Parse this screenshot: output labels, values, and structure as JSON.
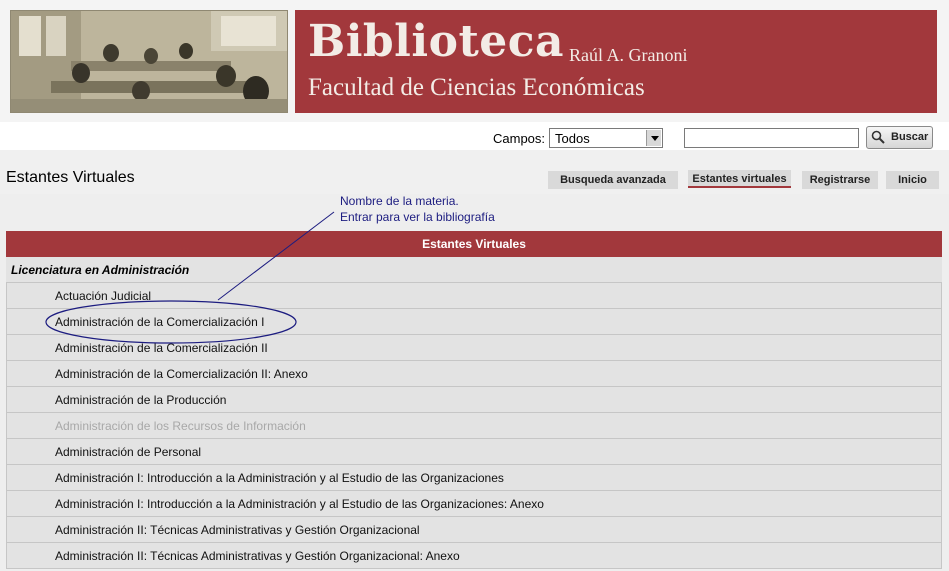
{
  "header": {
    "title": "Biblioteca",
    "author": "Raúl A. Granoni",
    "subtitle": "Facultad de Ciencias Económicas"
  },
  "search": {
    "campos_label": "Campos:",
    "campos_value": "Todos",
    "input_value": "",
    "button_label": "Buscar"
  },
  "page_title": "Estantes Virtuales",
  "nav": {
    "busqueda": "Busqueda avanzada",
    "estantes": "Estantes virtuales",
    "registrarse": "Registrarse",
    "inicio": "Inicio"
  },
  "annotation": {
    "line1": "Nombre de la materia.",
    "line2": "Entrar para ver la bibliografía"
  },
  "table": {
    "header": "Estantes Virtuales",
    "category": "Licenciatura en Administración",
    "items": [
      "Actuación Judicial",
      "Administración de la Comercialización I",
      "Administración de la Comercialización II",
      "Administración de la Comercialización II: Anexo",
      "Administración de la Producción",
      "Administración de los Recursos de Información",
      "Administración de Personal",
      "Administración I: Introducción a la Administración y al Estudio de las Organizaciones",
      "Administración I: Introducción a la Administración y al Estudio de las Organizaciones: Anexo",
      "Administración II: Técnicas Administrativas y Gestión Organizacional",
      "Administración II: Técnicas Administrativas y Gestión Organizacional: Anexo"
    ]
  },
  "colors": {
    "brand": "#a2383c",
    "annotation": "#1c1c80"
  }
}
